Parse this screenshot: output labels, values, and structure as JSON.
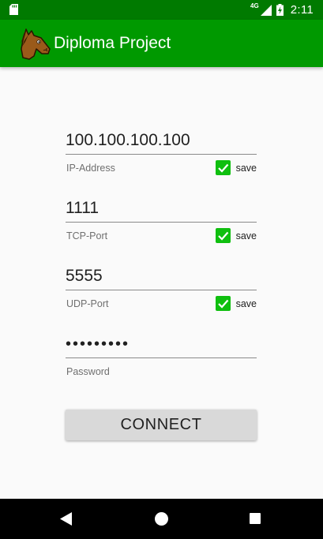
{
  "status_bar": {
    "network": "4G",
    "time": "2:11",
    "icons": [
      "sd-card-icon",
      "signal-icon",
      "battery-charging-icon"
    ]
  },
  "app_bar": {
    "title": "Diploma Project",
    "logo_icon": "horse-head-icon"
  },
  "form": {
    "ip": {
      "value": "100.100.100.100",
      "label": "IP-Address",
      "save_label": "save",
      "save_checked": true
    },
    "tcp": {
      "value": "1111",
      "label": "TCP-Port",
      "save_label": "save",
      "save_checked": true
    },
    "udp": {
      "value": "5555",
      "label": "UDP-Port",
      "save_label": "save",
      "save_checked": true
    },
    "password": {
      "value": "•••••••••",
      "label": "Password"
    }
  },
  "connect_button": {
    "label": "CONNECT"
  },
  "nav_bar": {
    "icons": [
      "back-icon",
      "home-icon",
      "recents-icon"
    ]
  },
  "colors": {
    "status_bar": "#007a00",
    "app_bar": "#009900",
    "checkbox": "#0fbf0f",
    "button": "#d9d9d9"
  }
}
